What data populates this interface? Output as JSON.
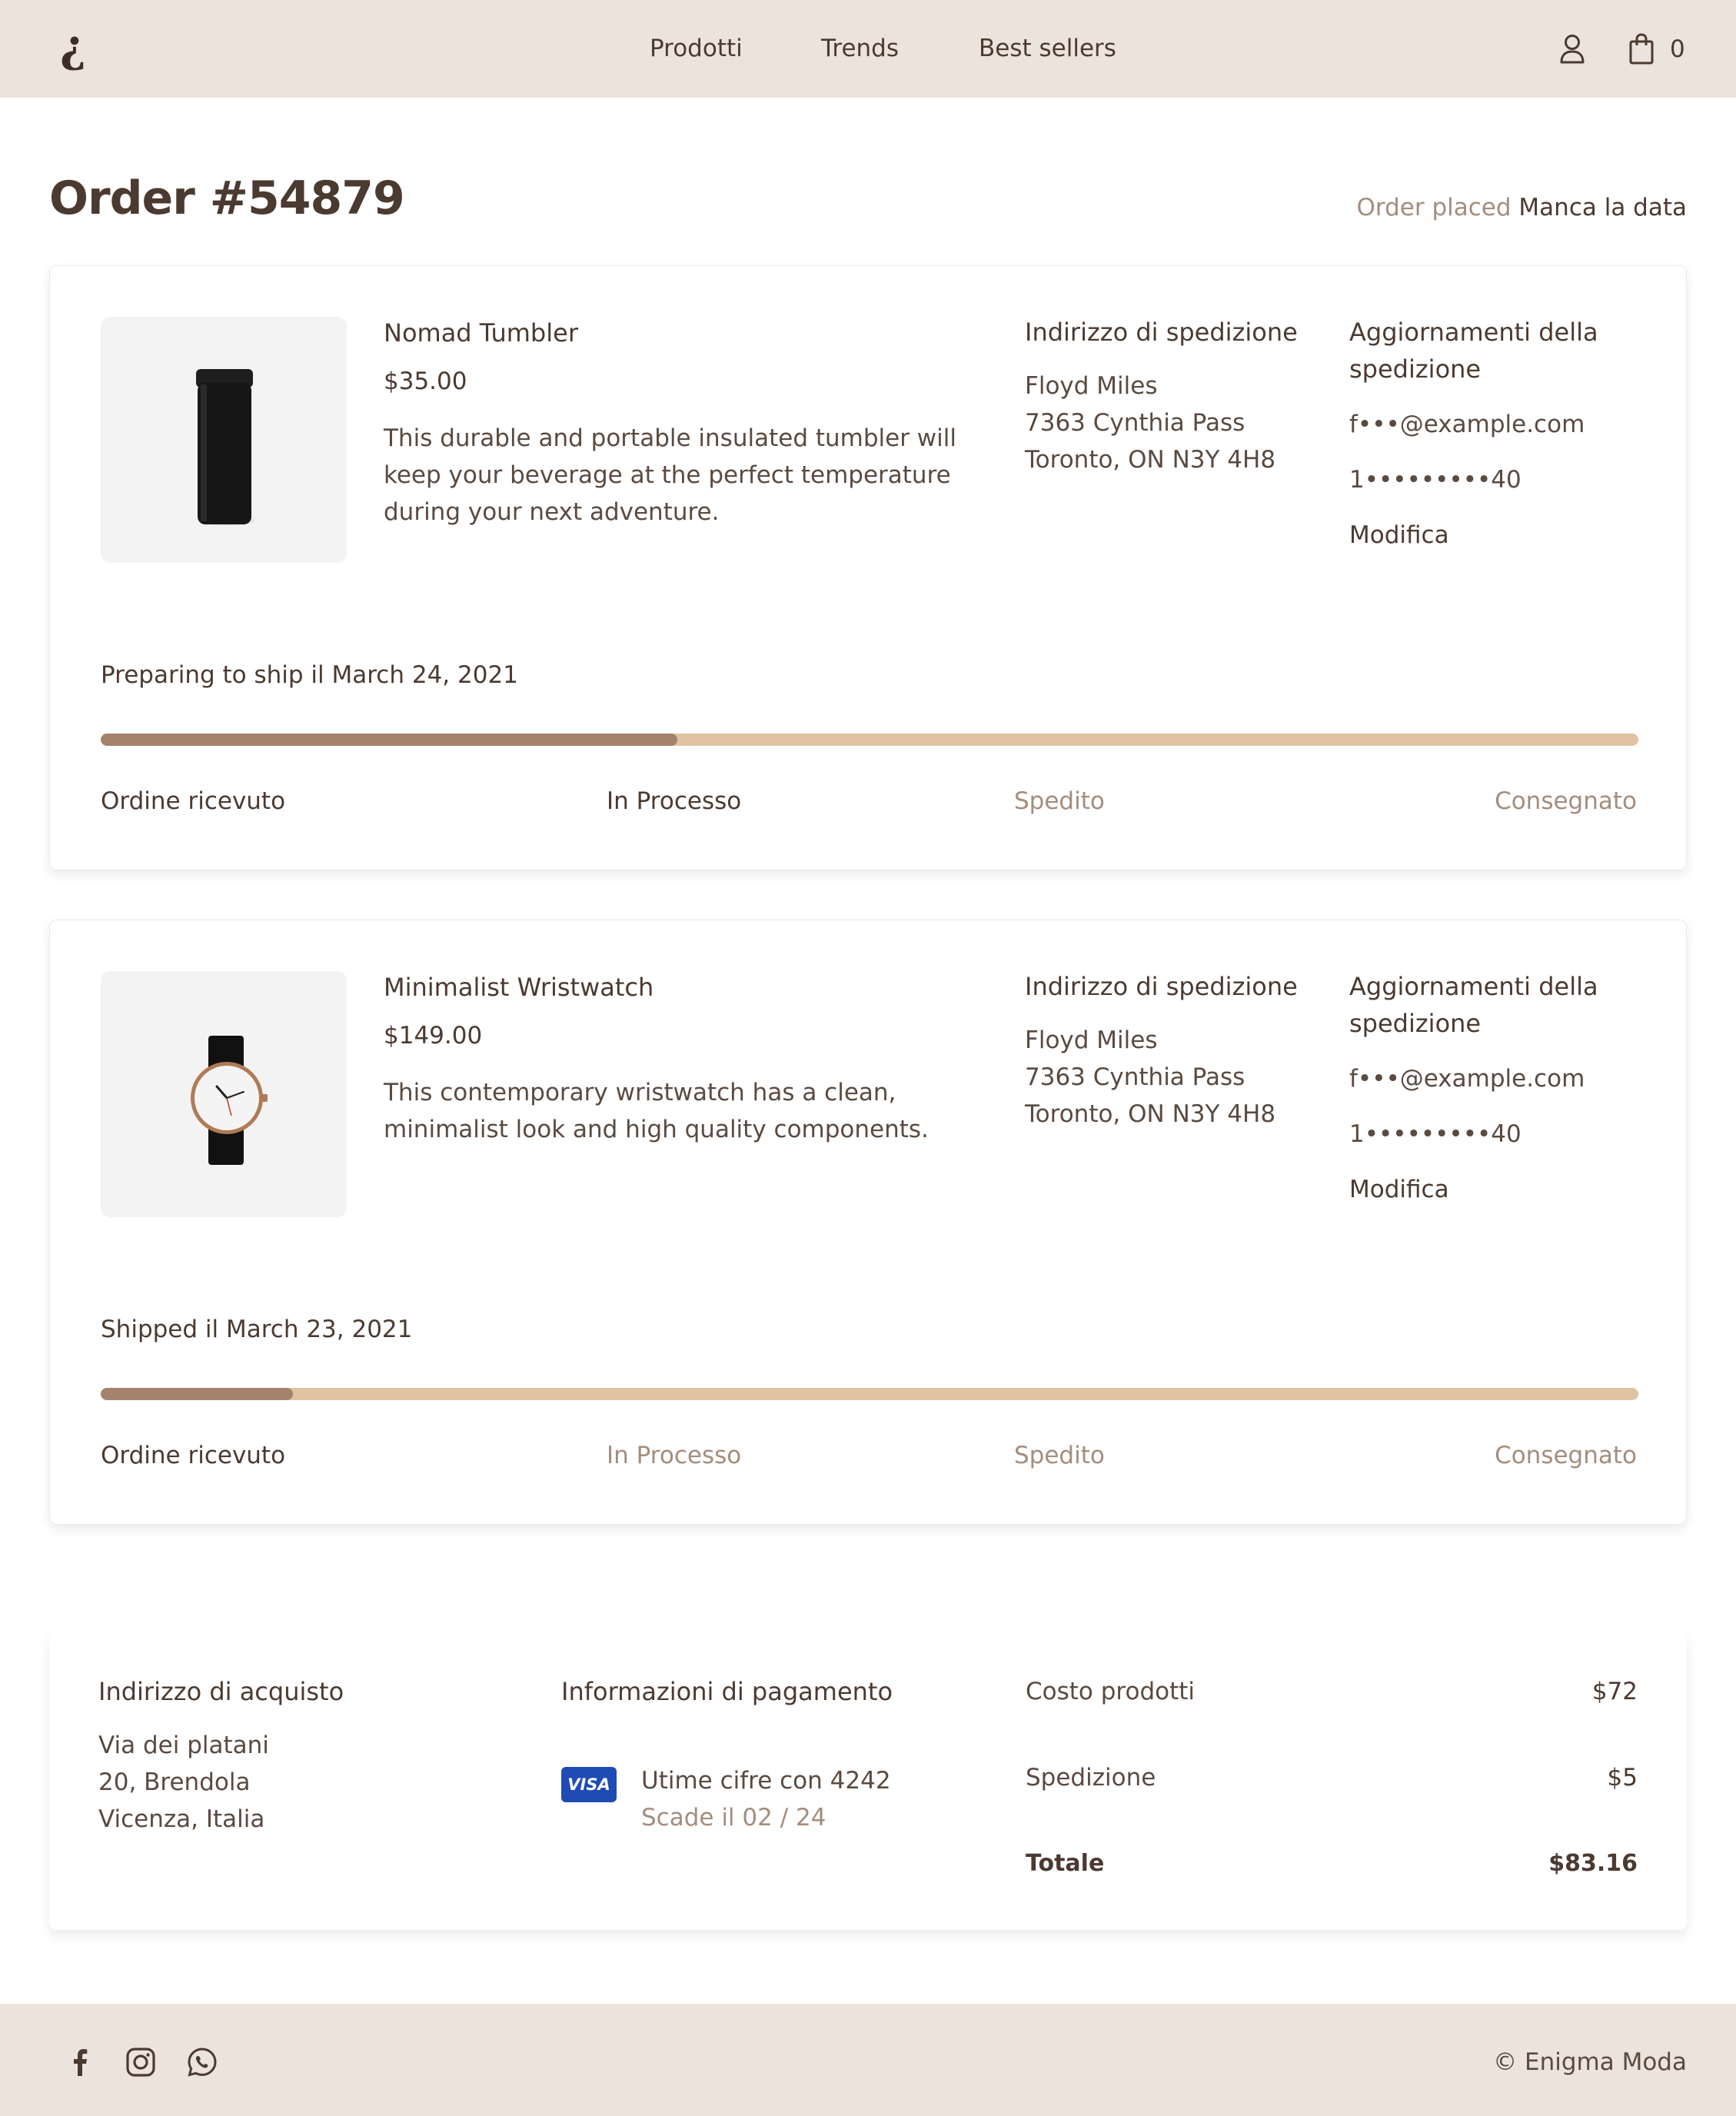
{
  "header": {
    "logo": "¿",
    "nav": [
      "Prodotti",
      "Trends",
      "Best sellers"
    ],
    "cart_count": "0"
  },
  "order": {
    "title": "Order #54879",
    "placed_label": "Order placed",
    "placed_value": "Manca la data"
  },
  "items": [
    {
      "name": "Nomad Tumbler",
      "price": "$35.00",
      "description": "This durable and portable insulated tumbler will keep your beverage at the perfect temperature during your next adventure.",
      "shipping_title": "Indirizzo di spedizione",
      "address": [
        "Floyd Miles",
        "7363 Cynthia Pass",
        "Toronto, ON N3Y 4H8"
      ],
      "updates_title": "Aggiornamenti della spedizione",
      "email": "f•••@example.com",
      "phone": "1•••••••••40",
      "edit_label": "Modifica",
      "status": "Preparing to ship il March 24, 2021",
      "progress": 0.375,
      "steps": [
        "Ordine ricevuto",
        "In Processo",
        "Spedito",
        "Consegnato"
      ]
    },
    {
      "name": "Minimalist Wristwatch",
      "price": "$149.00",
      "description": "This contemporary wristwatch has a clean, minimalist look and high quality components.",
      "shipping_title": "Indirizzo di spedizione",
      "address": [
        "Floyd Miles",
        "7363 Cynthia Pass",
        "Toronto, ON N3Y 4H8"
      ],
      "updates_title": "Aggiornamenti della spedizione",
      "email": "f•••@example.com",
      "phone": "1•••••••••40",
      "edit_label": "Modifica",
      "status": "Shipped il March 23, 2021",
      "progress": 0.125,
      "steps": [
        "Ordine ricevuto",
        "In Processo",
        "Spedito",
        "Consegnato"
      ]
    }
  ],
  "summary": {
    "billing_title": "Indirizzo di acquisto",
    "billing_lines": [
      "Via dei platani",
      "20, Brendola",
      "Vicenza, Italia"
    ],
    "payment_title": "Informazioni di pagamento",
    "card_brand": "VISA",
    "card_line": "Utime cifre con 4242",
    "card_exp": "Scade il 02 / 24",
    "subtotal_label": "Costo prodotti",
    "subtotal_value": "$72",
    "shipping_label": "Spedizione",
    "shipping_value": "$5",
    "total_label": "Totale",
    "total_value": "$83.16"
  },
  "footer": {
    "social": [
      "facebook-icon",
      "instagram-icon",
      "whatsapp-icon"
    ],
    "copyright": "© Enigma Moda"
  },
  "colors": {
    "header_bg": "#ede3dd",
    "text": "#4b3a30",
    "muted": "#a48d7d",
    "progress_track": "#dfc3a2",
    "progress_fill": "#a4826c",
    "visa": "#1f4bb5"
  }
}
